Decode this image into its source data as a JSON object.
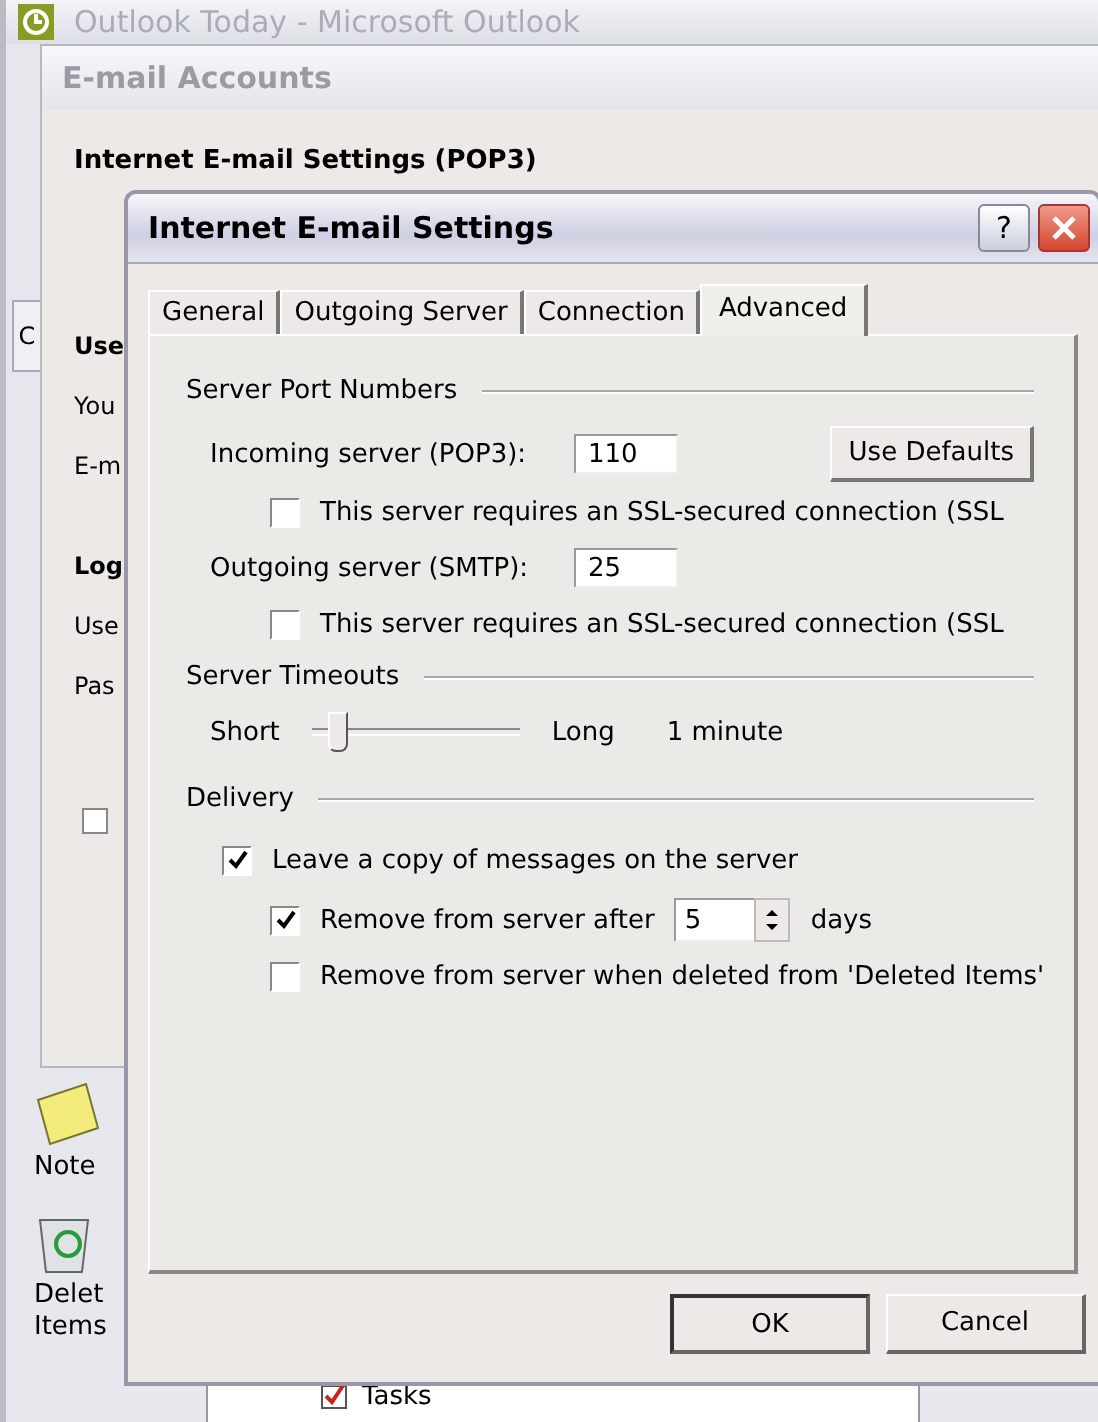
{
  "outlook_window": {
    "title": "Outlook Today - Microsoft Outlook"
  },
  "side_strip": {
    "label": "C"
  },
  "accounts_dialog": {
    "title": "E-mail Accounts",
    "heading": "Internet E-mail Settings (POP3)",
    "labels": [
      {
        "text": "Use",
        "kind": "heading"
      },
      {
        "text": "You",
        "kind": "label"
      },
      {
        "text": "E-m",
        "kind": "label"
      },
      {
        "text": "Log",
        "kind": "heading"
      },
      {
        "text": "Use",
        "kind": "label"
      },
      {
        "text": "Pas",
        "kind": "label"
      }
    ],
    "checkbox": {
      "checked": false
    }
  },
  "nav": [
    {
      "kind": "note",
      "lines": [
        "Note"
      ]
    },
    {
      "kind": "trash",
      "lines": [
        "Delet",
        "Items"
      ]
    }
  ],
  "folder_tree": [
    {
      "label": "Tasks"
    }
  ],
  "dialog": {
    "title": "Internet E-mail Settings",
    "help_button": "?",
    "tabs": [
      {
        "label": "General",
        "selected": false
      },
      {
        "label": "Outgoing Server",
        "selected": false
      },
      {
        "label": "Connection",
        "selected": false
      },
      {
        "label": "Advanced",
        "selected": true
      }
    ],
    "ports": {
      "title": "Server Port Numbers",
      "incoming_label": "Incoming server (POP3):",
      "incoming_value": "110",
      "defaults_button": "Use Defaults",
      "incoming_ssl": {
        "label": "This server requires an SSL-secured connection (SSL",
        "checked": false
      },
      "outgoing_label": "Outgoing server (SMTP):",
      "outgoing_value": "25",
      "outgoing_ssl": {
        "label": "This server requires an SSL-secured connection (SSL",
        "checked": false
      }
    },
    "timeouts": {
      "title": "Server Timeouts",
      "min_label": "Short",
      "max_label": "Long",
      "level": 0.12,
      "reading": "1 minute"
    },
    "delivery": {
      "title": "Delivery",
      "leave_copy": {
        "label": "Leave a copy of messages on the server",
        "checked": true
      },
      "remove_after": {
        "label": "Remove from server after",
        "checked": true,
        "value": "5",
        "unit": "days"
      },
      "remove_deleted": {
        "label": "Remove from server when deleted from 'Deleted Items'",
        "checked": false
      }
    },
    "buttons": [
      {
        "label": "OK",
        "default": true
      },
      {
        "label": "Cancel",
        "default": false
      }
    ]
  }
}
